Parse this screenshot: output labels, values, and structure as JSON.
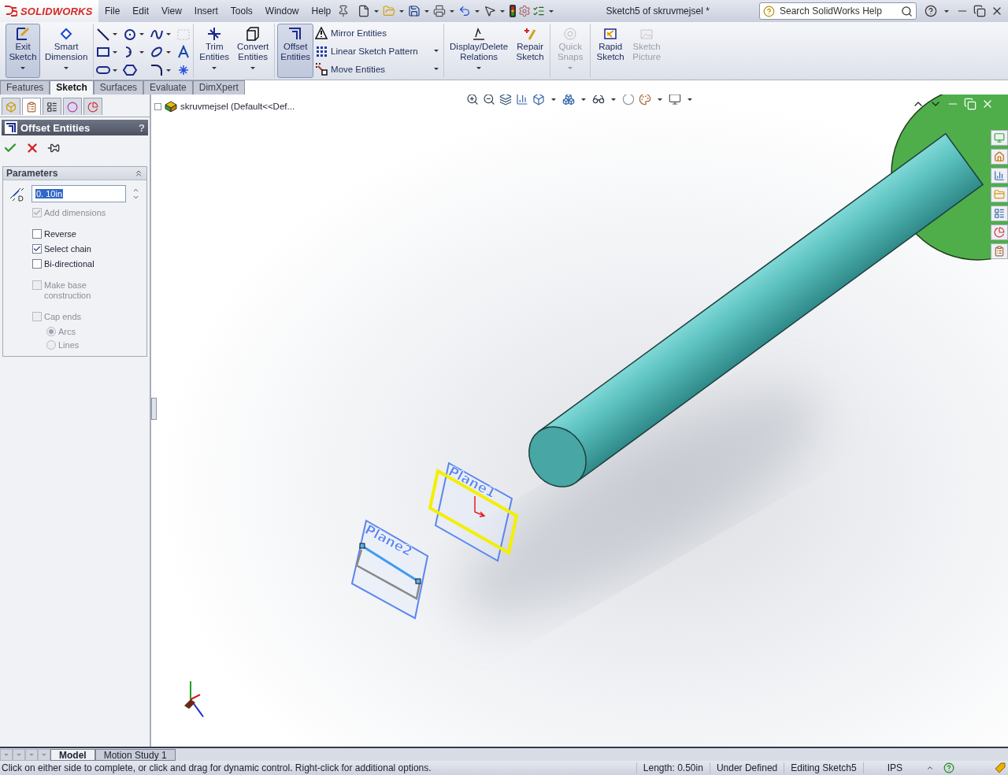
{
  "logo": {
    "text": "SOLIDWORKS"
  },
  "menu": [
    "File",
    "Edit",
    "View",
    "Insert",
    "Tools",
    "Window",
    "Help"
  ],
  "window": {
    "title": "Sketch5 of skruvmejsel *"
  },
  "search": {
    "placeholder": "Search SolidWorks Help"
  },
  "ribbon": [
    {
      "items": [
        {
          "kind": "large",
          "lines": [
            "Exit",
            "Sketch"
          ],
          "selected": true,
          "disabled": false,
          "dropdown": true
        },
        {
          "kind": "large",
          "lines": [
            "Smart",
            "Dimension"
          ],
          "selected": false,
          "disabled": false,
          "dropdown": true
        }
      ]
    },
    {
      "items": [
        {
          "kind": "sketch-tools"
        }
      ]
    },
    {
      "items": [
        {
          "kind": "large",
          "lines": [
            "Trim",
            "Entities"
          ],
          "selected": false,
          "disabled": false,
          "dropdown": true
        },
        {
          "kind": "large",
          "lines": [
            "Convert",
            "Entities"
          ],
          "selected": false,
          "disabled": false,
          "dropdown": true
        }
      ]
    },
    {
      "items": [
        {
          "kind": "large",
          "lines": [
            "Offset",
            "Entities"
          ],
          "selected": true,
          "disabled": false,
          "dropdown": false
        },
        {
          "kind": "list",
          "items": [
            {
              "label": "Mirror Entities",
              "dropdown": false
            },
            {
              "label": "Linear Sketch Pattern",
              "dropdown": true
            },
            {
              "label": "Move Entities",
              "dropdown": true
            }
          ]
        }
      ]
    },
    {
      "items": [
        {
          "kind": "large",
          "lines": [
            "Display/Delete",
            "Relations"
          ],
          "selected": false,
          "disabled": false,
          "dropdown": true
        },
        {
          "kind": "large",
          "lines": [
            "Repair",
            "Sketch"
          ],
          "selected": false,
          "disabled": false,
          "dropdown": false
        }
      ]
    },
    {
      "items": [
        {
          "kind": "large",
          "lines": [
            "Quick",
            "Snaps"
          ],
          "selected": false,
          "disabled": true,
          "dropdown": true
        }
      ]
    },
    {
      "items": [
        {
          "kind": "large",
          "lines": [
            "Rapid",
            "Sketch"
          ],
          "selected": false,
          "disabled": false,
          "dropdown": false
        },
        {
          "kind": "large",
          "lines": [
            "Sketch",
            "Picture"
          ],
          "selected": false,
          "disabled": true,
          "dropdown": false
        }
      ]
    }
  ],
  "command_tabs": [
    {
      "label": "Features",
      "selected": false
    },
    {
      "label": "Sketch",
      "selected": true
    },
    {
      "label": "Surfaces",
      "selected": false
    },
    {
      "label": "Evaluate",
      "selected": false
    },
    {
      "label": "DimXpert",
      "selected": false
    }
  ],
  "panel_tabs": [
    {
      "selected": false
    },
    {
      "selected": true
    },
    {
      "selected": false
    },
    {
      "selected": false
    },
    {
      "selected": false
    }
  ],
  "property_manager": {
    "title": "Offset Entities",
    "help": "?",
    "section": "Parameters",
    "distance": "0. 10in",
    "options": [
      {
        "label": "Add dimensions",
        "checked": true,
        "disabled": true
      },
      {
        "label": "Reverse",
        "checked": false,
        "disabled": false
      },
      {
        "label": "Select chain",
        "checked": true,
        "disabled": false
      },
      {
        "label": "Bi-directional",
        "checked": false,
        "disabled": false
      },
      {
        "label": "Make base construction",
        "checked": false,
        "disabled": true
      },
      {
        "label": "Cap ends",
        "checked": false,
        "disabled": true
      }
    ],
    "cap_types": [
      {
        "label": "Arcs",
        "selected": true,
        "disabled": true
      },
      {
        "label": "Lines",
        "selected": false,
        "disabled": true
      }
    ]
  },
  "tree": {
    "root": "skruvmejsel  (Default<<Def..."
  },
  "planes": [
    {
      "label": "Plane1",
      "selected": true
    },
    {
      "label": "Plane2",
      "selected": false
    }
  ],
  "bottom_tabs": [
    {
      "label": "Model",
      "selected": true
    },
    {
      "label": "Motion Study 1",
      "selected": false
    }
  ],
  "status_bar": {
    "message": "Click on either side to complete, or click and drag for dynamic control.  Right-click for additional options.",
    "fields": [
      "Length: 0.50in",
      "Under Defined",
      "Editing Sketch5"
    ],
    "units": "IPS"
  }
}
